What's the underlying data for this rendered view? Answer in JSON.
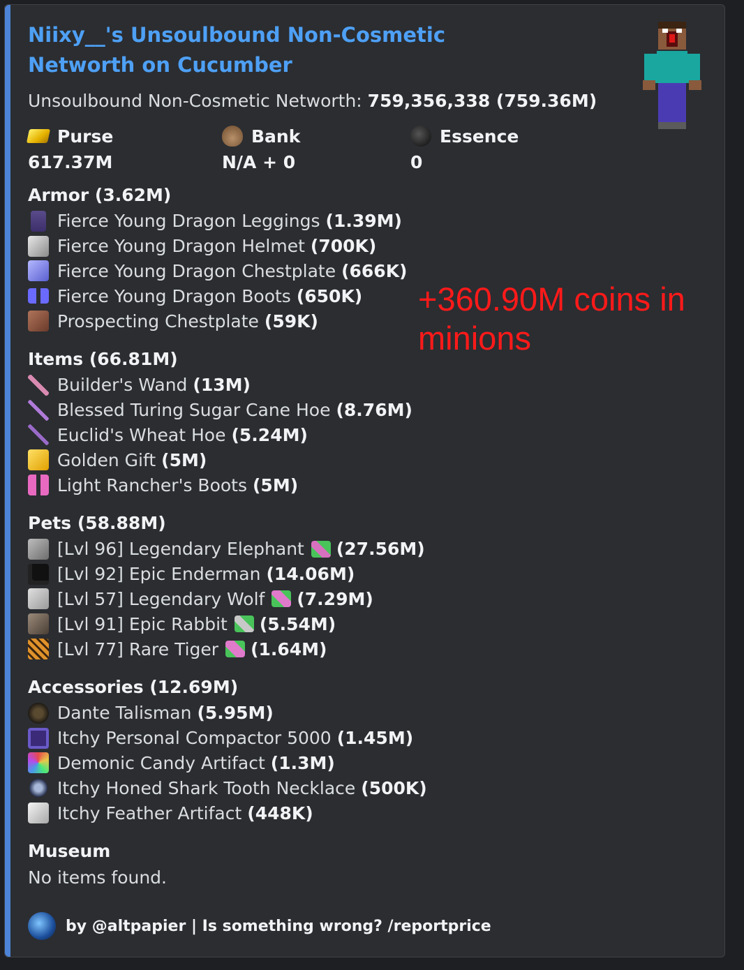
{
  "embed": {
    "title": "Niixy__'s Unsoulbound Non-Cosmetic Networth on Cucumber",
    "description_label": "Unsoulbound Non-Cosmetic Networth:",
    "description_value": "759,356,338 (759.36M)",
    "accent_color": "#4d84d8"
  },
  "fields": [
    {
      "icon": "gold-ingot-icon",
      "name": "Purse",
      "value": "617.37M"
    },
    {
      "icon": "bank-sack-icon",
      "name": "Bank",
      "value": "N/A + 0"
    },
    {
      "icon": "essence-icon",
      "name": "Essence",
      "value": "0"
    }
  ],
  "sections": {
    "armor": {
      "title": "Armor (3.62M)",
      "items": [
        {
          "icon": "leggings-icon",
          "name": "Fierce Young Dragon Leggings",
          "value": "(1.39M)"
        },
        {
          "icon": "helmet-icon",
          "name": "Fierce Young Dragon Helmet",
          "value": "(700K)"
        },
        {
          "icon": "chestplate-icon",
          "name": "Fierce Young Dragon Chestplate",
          "value": "(666K)"
        },
        {
          "icon": "boots-icon",
          "name": "Fierce Young Dragon Boots",
          "value": "(650K)"
        },
        {
          "icon": "chestplate-icon",
          "name": "Prospecting Chestplate",
          "value": "(59K)"
        }
      ]
    },
    "items": {
      "title": "Items (66.81M)",
      "items": [
        {
          "icon": "wand-icon",
          "name": "Builder's Wand",
          "value": "(13M)"
        },
        {
          "icon": "hoe-icon",
          "name": "Blessed Turing Sugar Cane Hoe",
          "value": "(8.76M)"
        },
        {
          "icon": "hoe-icon",
          "name": "Euclid's Wheat Hoe",
          "value": "(5.24M)"
        },
        {
          "icon": "gift-icon",
          "name": "Golden Gift",
          "value": "(5M)"
        },
        {
          "icon": "boots-icon",
          "name": "Light Rancher's Boots",
          "value": "(5M)"
        }
      ]
    },
    "pets": {
      "title": "Pets (58.88M)",
      "items": [
        {
          "icon": "elephant-head-icon",
          "name": "[Lvl 96] Legendary Elephant",
          "held_icon": "pet-item-icon",
          "value": "(27.56M)"
        },
        {
          "icon": "enderman-head-icon",
          "name": "[Lvl 92] Epic Enderman",
          "value": "(14.06M)"
        },
        {
          "icon": "wolf-head-icon",
          "name": "[Lvl 57] Legendary Wolf",
          "held_icon": "pet-item-icon",
          "value": "(7.29M)"
        },
        {
          "icon": "rabbit-head-icon",
          "name": "[Lvl 91] Epic Rabbit",
          "held_icon": "pet-item-icon",
          "value": "(5.54M)"
        },
        {
          "icon": "tiger-head-icon",
          "name": "[Lvl 77] Rare Tiger",
          "held_icon": "pet-item-icon",
          "value": "(1.64M)"
        }
      ]
    },
    "accessories": {
      "title": "Accessories (12.69M)",
      "items": [
        {
          "icon": "talisman-icon",
          "name": "Dante Talisman",
          "value": "(5.95M)"
        },
        {
          "icon": "compactor-icon",
          "name": "Itchy Personal Compactor 5000",
          "value": "(1.45M)"
        },
        {
          "icon": "candy-artifact-icon",
          "name": "Demonic Candy Artifact",
          "value": "(1.3M)"
        },
        {
          "icon": "necklace-icon",
          "name": "Itchy Honed Shark Tooth Necklace",
          "value": "(500K)"
        },
        {
          "icon": "feather-artifact-icon",
          "name": "Itchy Feather Artifact",
          "value": "(448K)"
        }
      ]
    },
    "museum": {
      "title": "Museum",
      "text": "No items found."
    }
  },
  "overlay_text": "+360.90M coins in minions",
  "footer": {
    "text": "by @altpapier | Is something wrong? /reportprice"
  }
}
